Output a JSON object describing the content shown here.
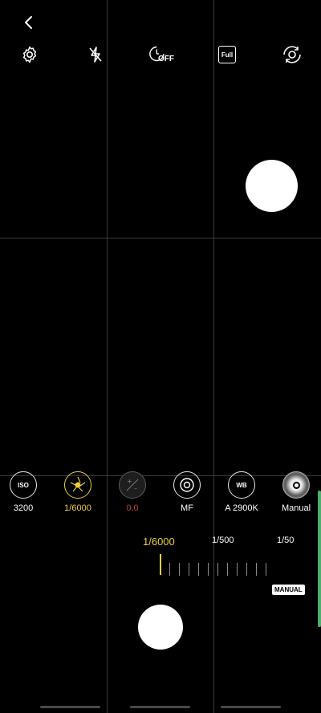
{
  "top_bar": {
    "icons": [
      "back-icon",
      "settings-icon",
      "flash-off-icon",
      "timer-off-icon",
      "aspect-full-icon",
      "switch-camera-icon"
    ],
    "timer_badge": "OFF",
    "aspect_label": "Full"
  },
  "pro_controls": [
    {
      "id": "iso",
      "icon_text": "ISO",
      "value": "3200"
    },
    {
      "id": "shutter",
      "icon_text": "",
      "value": "1/6000"
    },
    {
      "id": "ev",
      "icon_text": "",
      "value": "0.0"
    },
    {
      "id": "focus",
      "icon_text": "",
      "value": "MF"
    },
    {
      "id": "wb",
      "icon_text": "WB",
      "value": "A 2900K"
    },
    {
      "id": "manual",
      "icon_text": "",
      "value": "Manual"
    }
  ],
  "shutter_scale": {
    "selected": "1/6000",
    "labels": [
      "1/6000",
      "1/500",
      "1/50"
    ]
  },
  "manual_badge": "MANUAL",
  "colors": {
    "accent": "#e8cf3e",
    "handle": "#4caf6e",
    "disabled": "#c0392b"
  }
}
